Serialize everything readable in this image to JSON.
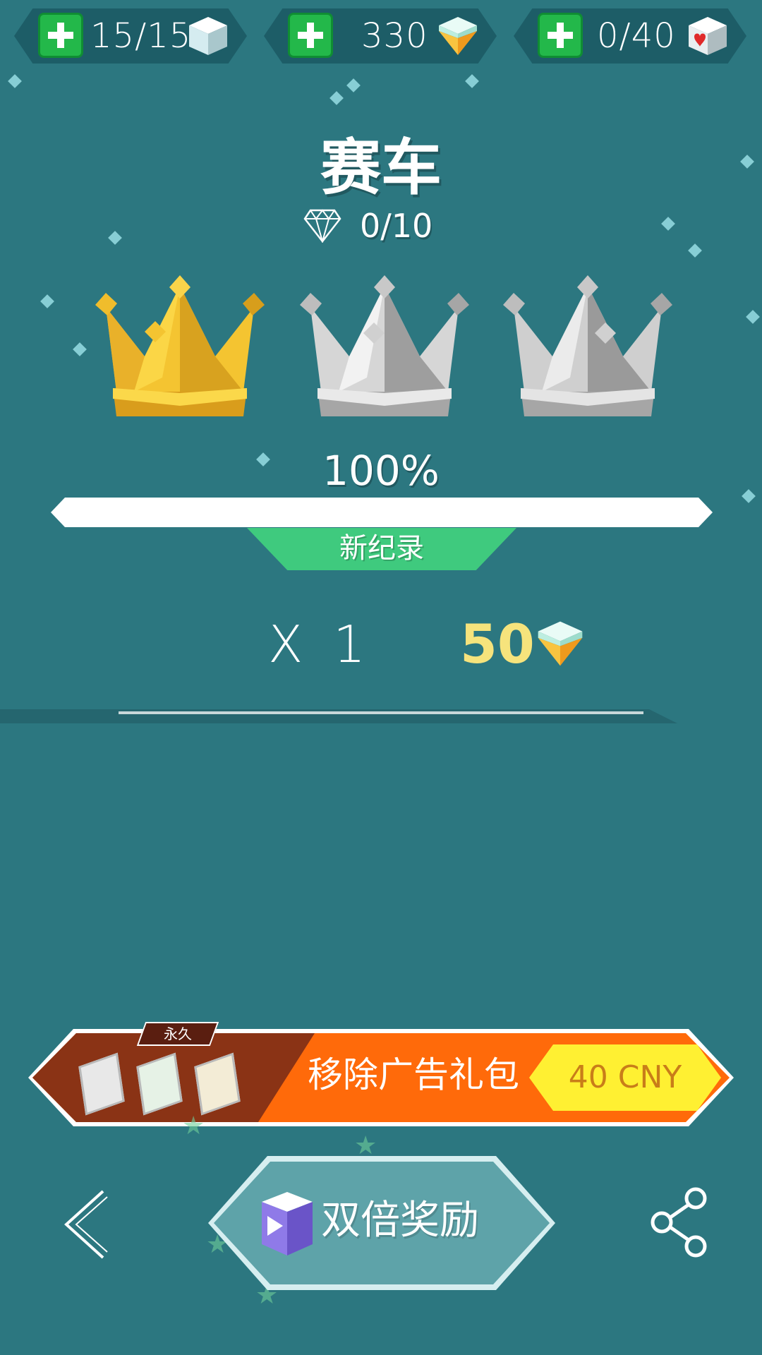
{
  "resources": [
    {
      "value": "15/15",
      "icon": "ice-cube-icon"
    },
    {
      "value": "330",
      "icon": "gold-gem-icon"
    },
    {
      "value": "0/40",
      "icon": "heart-cube-icon"
    }
  ],
  "level": {
    "title": "赛车",
    "gems": "0/10"
  },
  "crowns": {
    "earned": 1,
    "total": 3
  },
  "progress": {
    "percent_text": "100%",
    "value": 1.0,
    "badge": "新纪录"
  },
  "reward": {
    "multiplier": "X 1",
    "amount": "50"
  },
  "banner": {
    "tag": "永久",
    "text": "移除广告礼包",
    "price": "40 CNY"
  },
  "actions": {
    "double_label": "双倍奖励"
  },
  "colors": {
    "background": "#2c7780",
    "gold": "#f6e37c",
    "green": "#3fca7e",
    "orange": "#ff6a0a",
    "price": "#fff032"
  }
}
